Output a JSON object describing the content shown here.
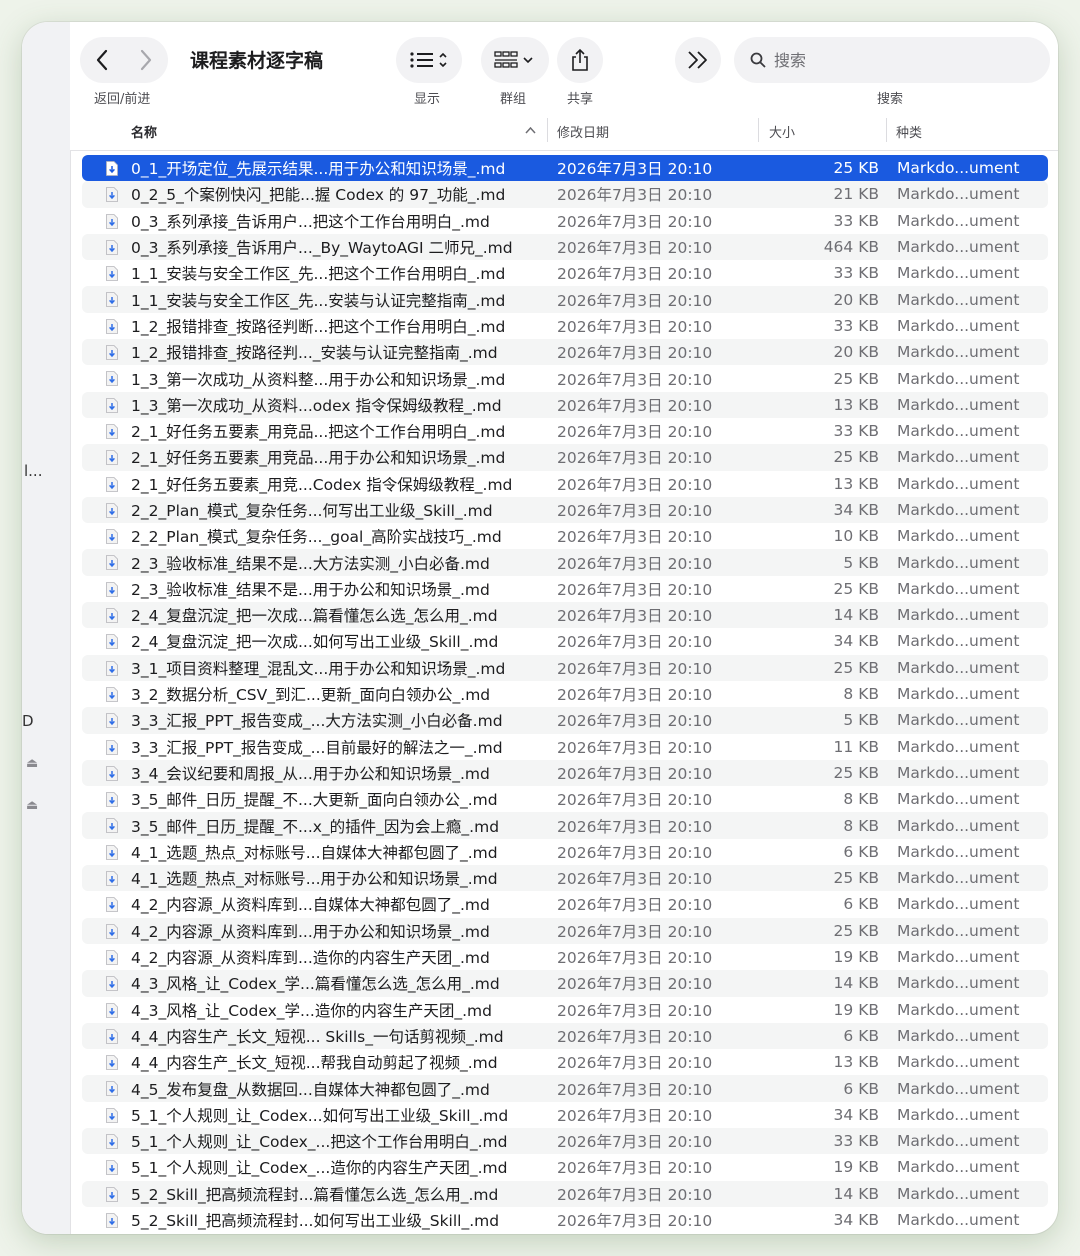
{
  "window": {
    "title": "课程素材逐字稿"
  },
  "sidebar": {
    "truncated_item": "l...",
    "truncated_item_2": "D"
  },
  "toolbar": {
    "nav_label": "返回/前进",
    "view_label": "显示",
    "group_label": "群组",
    "share_label": "共享",
    "search_label": "搜索",
    "search_placeholder": "搜索"
  },
  "columns": {
    "name": "名称",
    "date": "修改日期",
    "size": "大小",
    "kind": "种类"
  },
  "accent_color": "#1a5ae0",
  "files": [
    {
      "name": "0_1_开场定位_先展示结果...用于办公和知识场景_.md",
      "date": "2026年7月3日 20:10",
      "size": "25 KB",
      "kind": "Markdo...ument",
      "selected": true
    },
    {
      "name": "0_2_5_个案例快闪_把能...握 Codex 的 97_功能_.md",
      "date": "2026年7月3日 20:10",
      "size": "21 KB",
      "kind": "Markdo...ument"
    },
    {
      "name": "0_3_系列承接_告诉用户...把这个工作台用明白_.md",
      "date": "2026年7月3日 20:10",
      "size": "33 KB",
      "kind": "Markdo...ument"
    },
    {
      "name": "0_3_系列承接_告诉用户..._By_WaytoAGI 二师兄_.md",
      "date": "2026年7月3日 20:10",
      "size": "464 KB",
      "kind": "Markdo...ument"
    },
    {
      "name": "1_1_安装与安全工作区_先...把这个工作台用明白_.md",
      "date": "2026年7月3日 20:10",
      "size": "33 KB",
      "kind": "Markdo...ument"
    },
    {
      "name": "1_1_安装与安全工作区_先...安装与认证完整指南_.md",
      "date": "2026年7月3日 20:10",
      "size": "20 KB",
      "kind": "Markdo...ument"
    },
    {
      "name": "1_2_报错排查_按路径判断...把这个工作台用明白_.md",
      "date": "2026年7月3日 20:10",
      "size": "33 KB",
      "kind": "Markdo...ument"
    },
    {
      "name": "1_2_报错排查_按路径判..._安装与认证完整指南_.md",
      "date": "2026年7月3日 20:10",
      "size": "20 KB",
      "kind": "Markdo...ument"
    },
    {
      "name": "1_3_第一次成功_从资料整...用于办公和知识场景_.md",
      "date": "2026年7月3日 20:10",
      "size": "25 KB",
      "kind": "Markdo...ument"
    },
    {
      "name": "1_3_第一次成功_从资料...odex 指令保姆级教程_.md",
      "date": "2026年7月3日 20:10",
      "size": "13 KB",
      "kind": "Markdo...ument"
    },
    {
      "name": "2_1_好任务五要素_用竞品...把这个工作台用明白_.md",
      "date": "2026年7月3日 20:10",
      "size": "33 KB",
      "kind": "Markdo...ument"
    },
    {
      "name": "2_1_好任务五要素_用竞品...用于办公和知识场景_.md",
      "date": "2026年7月3日 20:10",
      "size": "25 KB",
      "kind": "Markdo...ument"
    },
    {
      "name": "2_1_好任务五要素_用竞...Codex 指令保姆级教程_.md",
      "date": "2026年7月3日 20:10",
      "size": "13 KB",
      "kind": "Markdo...ument"
    },
    {
      "name": "2_2_Plan_模式_复杂任务...何写出工业级_Skill_.md",
      "date": "2026年7月3日 20:10",
      "size": "34 KB",
      "kind": "Markdo...ument"
    },
    {
      "name": "2_2_Plan_模式_复杂任务..._goal_高阶实战技巧_.md",
      "date": "2026年7月3日 20:10",
      "size": "10 KB",
      "kind": "Markdo...ument"
    },
    {
      "name": "2_3_验收标准_结果不是...大方法实测_小白必备.md",
      "date": "2026年7月3日 20:10",
      "size": "5 KB",
      "kind": "Markdo...ument"
    },
    {
      "name": "2_3_验收标准_结果不是...用于办公和知识场景_.md",
      "date": "2026年7月3日 20:10",
      "size": "25 KB",
      "kind": "Markdo...ument"
    },
    {
      "name": "2_4_复盘沉淀_把一次成...篇看懂怎么选_怎么用_.md",
      "date": "2026年7月3日 20:10",
      "size": "14 KB",
      "kind": "Markdo...ument"
    },
    {
      "name": "2_4_复盘沉淀_把一次成...如何写出工业级_Skill_.md",
      "date": "2026年7月3日 20:10",
      "size": "34 KB",
      "kind": "Markdo...ument"
    },
    {
      "name": "3_1_项目资料整理_混乱文...用于办公和知识场景_.md",
      "date": "2026年7月3日 20:10",
      "size": "25 KB",
      "kind": "Markdo...ument"
    },
    {
      "name": "3_2_数据分析_CSV_到汇...更新_面向白领办公_.md",
      "date": "2026年7月3日 20:10",
      "size": "8 KB",
      "kind": "Markdo...ument"
    },
    {
      "name": "3_3_汇报_PPT_报告变成_...大方法实测_小白必备.md",
      "date": "2026年7月3日 20:10",
      "size": "5 KB",
      "kind": "Markdo...ument"
    },
    {
      "name": "3_3_汇报_PPT_报告变成_...目前最好的解法之一_.md",
      "date": "2026年7月3日 20:10",
      "size": "11 KB",
      "kind": "Markdo...ument"
    },
    {
      "name": "3_4_会议纪要和周报_从...用于办公和知识场景_.md",
      "date": "2026年7月3日 20:10",
      "size": "25 KB",
      "kind": "Markdo...ument"
    },
    {
      "name": "3_5_邮件_日历_提醒_不...大更新_面向白领办公_.md",
      "date": "2026年7月3日 20:10",
      "size": "8 KB",
      "kind": "Markdo...ument"
    },
    {
      "name": "3_5_邮件_日历_提醒_不...x_的插件_因为会上瘾_.md",
      "date": "2026年7月3日 20:10",
      "size": "8 KB",
      "kind": "Markdo...ument"
    },
    {
      "name": "4_1_选题_热点_对标账号...自媒体大神都包圆了_.md",
      "date": "2026年7月3日 20:10",
      "size": "6 KB",
      "kind": "Markdo...ument"
    },
    {
      "name": "4_1_选题_热点_对标账号...用于办公和知识场景_.md",
      "date": "2026年7月3日 20:10",
      "size": "25 KB",
      "kind": "Markdo...ument"
    },
    {
      "name": "4_2_内容源_从资料库到...自媒体大神都包圆了_.md",
      "date": "2026年7月3日 20:10",
      "size": "6 KB",
      "kind": "Markdo...ument"
    },
    {
      "name": "4_2_内容源_从资料库到...用于办公和知识场景_.md",
      "date": "2026年7月3日 20:10",
      "size": "25 KB",
      "kind": "Markdo...ument"
    },
    {
      "name": "4_2_内容源_从资料库到...造你的内容生产天团_.md",
      "date": "2026年7月3日 20:10",
      "size": "19 KB",
      "kind": "Markdo...ument"
    },
    {
      "name": "4_3_风格_让_Codex_学...篇看懂怎么选_怎么用_.md",
      "date": "2026年7月3日 20:10",
      "size": "14 KB",
      "kind": "Markdo...ument"
    },
    {
      "name": "4_3_风格_让_Codex_学...造你的内容生产天团_.md",
      "date": "2026年7月3日 20:10",
      "size": "19 KB",
      "kind": "Markdo...ument"
    },
    {
      "name": "4_4_内容生产_长文_短视... Skills_一句话剪视频_.md",
      "date": "2026年7月3日 20:10",
      "size": "6 KB",
      "kind": "Markdo...ument"
    },
    {
      "name": "4_4_内容生产_长文_短视...帮我自动剪起了视频_.md",
      "date": "2026年7月3日 20:10",
      "size": "13 KB",
      "kind": "Markdo...ument"
    },
    {
      "name": "4_5_发布复盘_从数据回...自媒体大神都包圆了_.md",
      "date": "2026年7月3日 20:10",
      "size": "6 KB",
      "kind": "Markdo...ument"
    },
    {
      "name": "5_1_个人规则_让_Codex...如何写出工业级_Skill_.md",
      "date": "2026年7月3日 20:10",
      "size": "34 KB",
      "kind": "Markdo...ument"
    },
    {
      "name": "5_1_个人规则_让_Codex_...把这个工作台用明白_.md",
      "date": "2026年7月3日 20:10",
      "size": "33 KB",
      "kind": "Markdo...ument"
    },
    {
      "name": "5_1_个人规则_让_Codex_...造你的内容生产天团_.md",
      "date": "2026年7月3日 20:10",
      "size": "19 KB",
      "kind": "Markdo...ument"
    },
    {
      "name": "5_2_Skill_把高频流程封...篇看懂怎么选_怎么用_.md",
      "date": "2026年7月3日 20:10",
      "size": "14 KB",
      "kind": "Markdo...ument"
    },
    {
      "name": "5_2_Skill_把高频流程封...如何写出工业级_Skill_.md",
      "date": "2026年7月3日 20:10",
      "size": "34 KB",
      "kind": "Markdo...ument"
    }
  ]
}
